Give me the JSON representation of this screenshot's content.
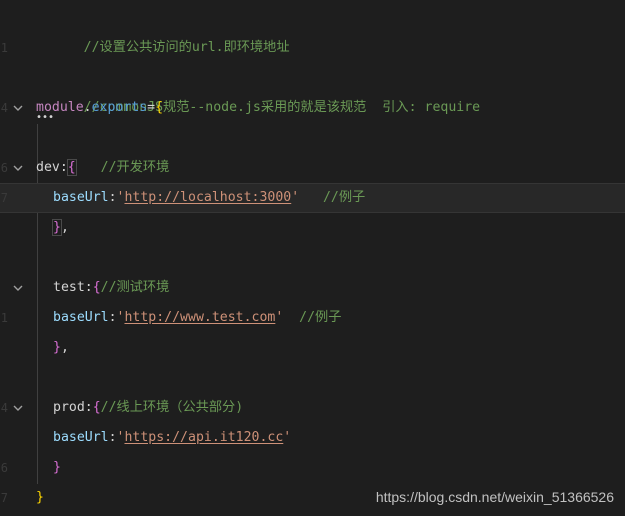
{
  "editor": {
    "line_numbers": [
      "",
      "1",
      "",
      "",
      "4",
      "",
      "6",
      "7",
      "",
      "",
      "",
      "1",
      "",
      "",
      "4",
      "",
      "6",
      "7"
    ],
    "lines": [
      {
        "tokens": [
          "//设置公共访问的url.即环境地址"
        ]
      },
      {
        "tokens": []
      },
      {
        "tokens": []
      },
      {
        "tokens": [
          "//commonJS规范--node.js采用的就是该规范  引入: require"
        ]
      },
      {
        "tokens": [
          "module",
          ".",
          "exports",
          "=",
          "{"
        ]
      },
      {
        "tokens": [
          "//开发环境"
        ]
      },
      {
        "tokens": [
          "dev",
          ":",
          "{"
        ]
      },
      {
        "tokens": [
          "baseUrl",
          ":",
          "'",
          "http://localhost:3000",
          "'",
          "   //例子"
        ]
      },
      {
        "tokens": [
          "}",
          ","
        ]
      },
      {
        "tokens": [
          "//测试环境"
        ]
      },
      {
        "tokens": [
          "test",
          ":",
          "{"
        ]
      },
      {
        "tokens": [
          "baseUrl",
          ":",
          "'",
          "http://www.test.com",
          "'",
          "  //例子"
        ]
      },
      {
        "tokens": [
          "}",
          ","
        ]
      },
      {
        "tokens": [
          "//线上环境（公共部分)"
        ]
      },
      {
        "tokens": [
          "prod",
          ":",
          "{"
        ]
      },
      {
        "tokens": [
          "baseUrl",
          ":",
          "'",
          "https://api.it120.cc",
          "'"
        ]
      },
      {
        "tokens": [
          "}"
        ]
      },
      {
        "tokens": [
          "}"
        ]
      }
    ],
    "collapsed_marker": "•••"
  },
  "watermark": {
    "text": "https://blog.csdn.net/weixin_51366526"
  },
  "icons": {
    "fold": "chevron-down-icon"
  },
  "colors": {
    "background": "#1e1e1e",
    "comment": "#6a9955",
    "string": "#ce9178",
    "key": "#9cdcfe",
    "brace_outer": "#ffd700",
    "brace_inner": "#da70d6"
  }
}
